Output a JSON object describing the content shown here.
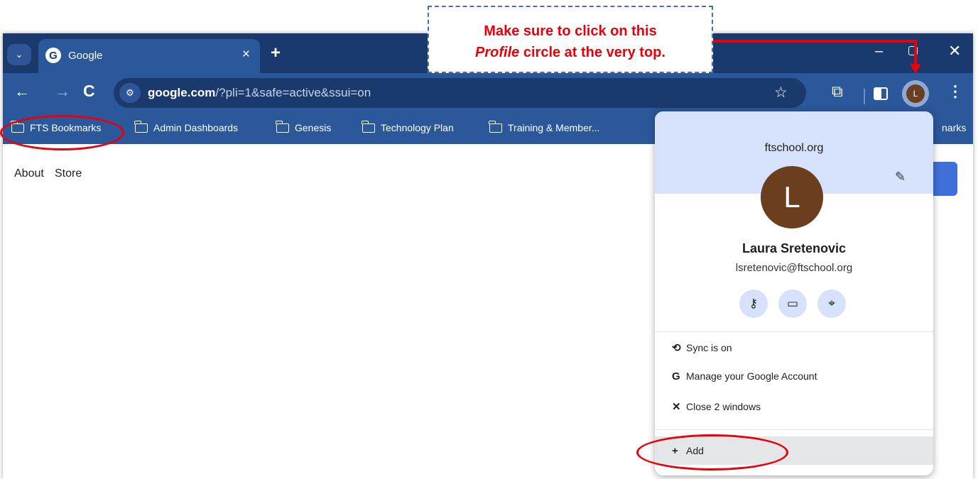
{
  "browser": {
    "tab": {
      "title": "Google",
      "favicon": "G",
      "close": "×"
    },
    "new_tab": "+",
    "window_controls": {
      "minimize": "–",
      "close": "✕"
    },
    "toolbar": {
      "back": "←",
      "forward": "→",
      "reload": "C",
      "url_host": "google.com",
      "url_path": "/?pli=1&safe=active&ssui=on",
      "star": "☆",
      "extensions": "⧉",
      "profile_initial": "L",
      "menu": "⋮"
    },
    "bookmarks": [
      {
        "label": "FTS Bookmarks"
      },
      {
        "label": "Admin Dashboards"
      },
      {
        "label": "Genesis"
      },
      {
        "label": "Technology Plan"
      },
      {
        "label": "Training & Member..."
      }
    ],
    "bookmarks_overflow": "narks"
  },
  "page": {
    "links": [
      "About",
      "Store"
    ]
  },
  "profile_menu": {
    "domain": "ftschool.org",
    "edit_icon": "✎",
    "avatar_initial": "L",
    "name": "Laura Sretenovic",
    "email": "lsretenovic@ftschool.org",
    "quick_icons": [
      "key-icon",
      "credit-card-icon",
      "location-pin-icon"
    ],
    "items": [
      {
        "icon": "sync-icon",
        "glyph": "⟲",
        "label": "Sync is on"
      },
      {
        "icon": "google-icon",
        "glyph": "G",
        "label": "Manage your Google Account"
      },
      {
        "icon": "close-icon",
        "glyph": "✕",
        "label": "Close 2 windows"
      }
    ],
    "add": {
      "glyph": "+",
      "label": "Add"
    }
  },
  "callout": {
    "line1": "Make sure to click on this",
    "line2_em": "Profile",
    "line2_rest": " circle at the very top."
  },
  "colors": {
    "tab_strip": "#1a3a6e",
    "toolbar": "#2b579b",
    "annotation_red": "#e8000a",
    "menu_header": "#d6e2fb",
    "avatar": "#6b3f1d"
  }
}
